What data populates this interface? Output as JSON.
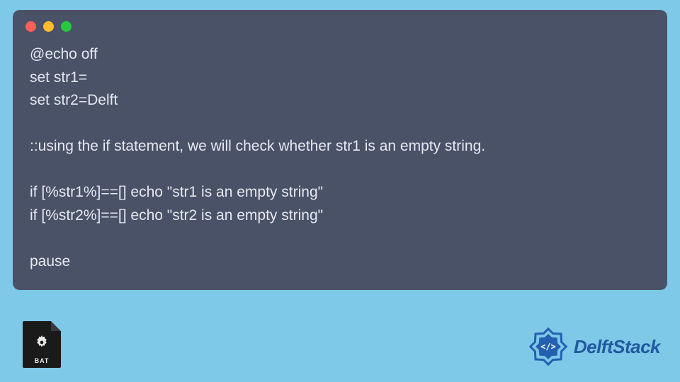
{
  "code": {
    "lines": [
      "@echo off",
      "set str1=",
      "set str2=Delft",
      "",
      "::using the if statement, we will check whether str1 is an empty string.",
      "",
      "if [%str1%]==[] echo \"str1 is an empty string\"",
      "if [%str2%]==[] echo \"str2 is an empty string\"",
      "",
      "pause"
    ]
  },
  "bat_icon": {
    "label": "BAT"
  },
  "logo": {
    "text": "DelftStack"
  },
  "colors": {
    "page_bg": "#7ec8e8",
    "window_bg": "#4a5268",
    "logo_text": "#215a9f"
  }
}
